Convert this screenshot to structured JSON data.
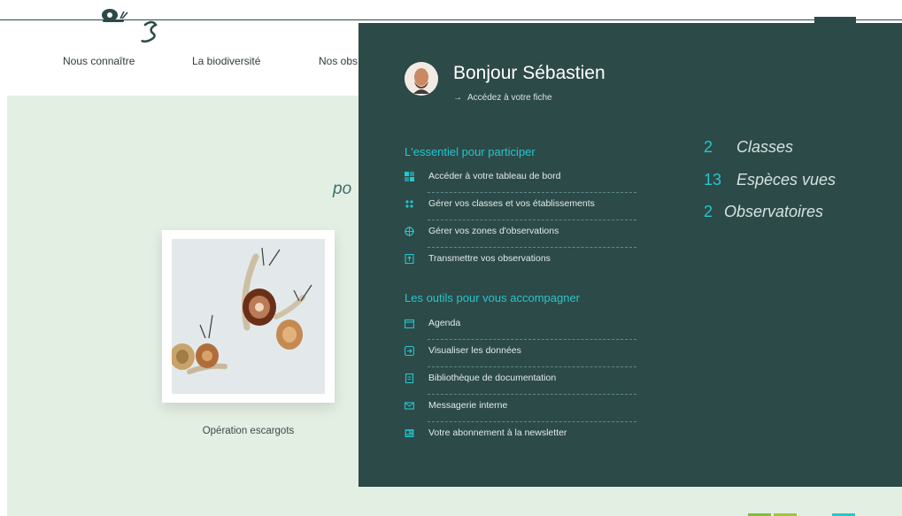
{
  "header": {
    "nav": [
      {
        "label": "Nous connaître"
      },
      {
        "label": "La biodiversité"
      },
      {
        "label": "Nos obs"
      }
    ]
  },
  "hero": {
    "title_fragment": "po",
    "card_caption": "Opération escargots"
  },
  "account_panel": {
    "greeting": "Bonjour Sébastien",
    "fiche_link": "Accédez à votre fiche",
    "sections": [
      {
        "title": "L'essentiel pour participer",
        "items": [
          {
            "label": "Accéder à votre tableau de bord",
            "icon": "dashboard-icon"
          },
          {
            "label": "Gérer vos classes et vos établissements",
            "icon": "classes-icon"
          },
          {
            "label": "Gérer vos zones d'observations",
            "icon": "zones-icon"
          },
          {
            "label": "Transmettre vos observations",
            "icon": "upload-icon"
          }
        ]
      },
      {
        "title": "Les outils pour vous accompagner",
        "items": [
          {
            "label": "Agenda",
            "icon": "calendar-icon"
          },
          {
            "label": "Visualiser les données",
            "icon": "data-icon"
          },
          {
            "label": "Bibliothèque de documentation",
            "icon": "library-icon"
          },
          {
            "label": "Messagerie interne",
            "icon": "mail-icon"
          },
          {
            "label": "Votre abonnement à la newsletter",
            "icon": "newsletter-icon"
          }
        ]
      }
    ],
    "stats": [
      {
        "value": "2",
        "label": "Classes"
      },
      {
        "value": "13",
        "label": "Espèces vues"
      },
      {
        "value": "2",
        "label": "Observatoires"
      }
    ]
  },
  "colors": {
    "panel_bg": "#2c4a48",
    "accent": "#26c6cf",
    "hero_bg": "#e4efe3"
  }
}
